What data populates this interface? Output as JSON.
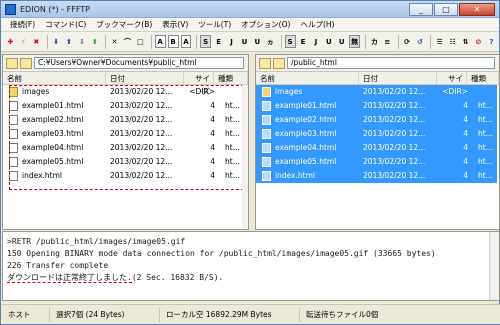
{
  "window": {
    "title": "EDION (*) - FFFTP"
  },
  "menu": [
    "接続(F)",
    "コマンド(C)",
    "ブックマーク(B)",
    "表示(V)",
    "ツール(T)",
    "オプション(O)",
    "ヘルプ(H)"
  ],
  "left_pane": {
    "path": "C:¥Users¥Owner¥Documents¥public_html",
    "columns": {
      "name": "名前",
      "date": "日付",
      "size": "サイズ",
      "kind": "種類"
    },
    "rows": [
      {
        "name": "images",
        "date": "2013/02/20 12...",
        "size": "<DIR>",
        "kind": "",
        "folder": true
      },
      {
        "name": "example01.html",
        "date": "2013/02/20 12...",
        "size": "4",
        "kind": "ht..."
      },
      {
        "name": "example02.html",
        "date": "2013/02/20 12...",
        "size": "4",
        "kind": "ht..."
      },
      {
        "name": "example03.html",
        "date": "2013/02/20 12...",
        "size": "4",
        "kind": "ht..."
      },
      {
        "name": "example04.html",
        "date": "2013/02/20 12...",
        "size": "4",
        "kind": "ht..."
      },
      {
        "name": "example05.html",
        "date": "2013/02/20 12...",
        "size": "4",
        "kind": "ht..."
      },
      {
        "name": "index.html",
        "date": "2013/02/20 12...",
        "size": "4",
        "kind": "ht..."
      }
    ]
  },
  "right_pane": {
    "path": "/public_html",
    "columns": {
      "name": "名前",
      "date": "日付",
      "size": "サイズ",
      "kind": "種類"
    },
    "rows": [
      {
        "name": "images",
        "date": "2013/02/20 12...",
        "size": "<DIR>",
        "kind": "",
        "folder": true
      },
      {
        "name": "example01.html",
        "date": "2013/02/20 12...",
        "size": "4",
        "kind": "ht..."
      },
      {
        "name": "example02.html",
        "date": "2013/02/20 12...",
        "size": "4",
        "kind": "ht..."
      },
      {
        "name": "example03.html",
        "date": "2013/02/20 12...",
        "size": "4",
        "kind": "ht..."
      },
      {
        "name": "example04.html",
        "date": "2013/02/20 12...",
        "size": "4",
        "kind": "ht..."
      },
      {
        "name": "example05.html",
        "date": "2013/02/20 12...",
        "size": "4",
        "kind": "ht..."
      },
      {
        "name": "index.html",
        "date": "2013/02/20 12...",
        "size": "4",
        "kind": "ht..."
      }
    ]
  },
  "log": {
    "line1": ">RETR /public_html/images/image05.gif",
    "line2": "150 Opening BINARY mode data connection for /public_html/images/image05.gif (33665 bytes)",
    "line3": "226 Transfer complete",
    "line4_main": "ダウンロードは正常終了しました.",
    "line4_rest": "(2 Sec. 16832 B/S)."
  },
  "status": {
    "host": "ホスト",
    "selected": "選択7個 (24 Bytes)",
    "local": "ローカル空 16892.29M Bytes",
    "queue": "転送待ちファイル0個"
  }
}
